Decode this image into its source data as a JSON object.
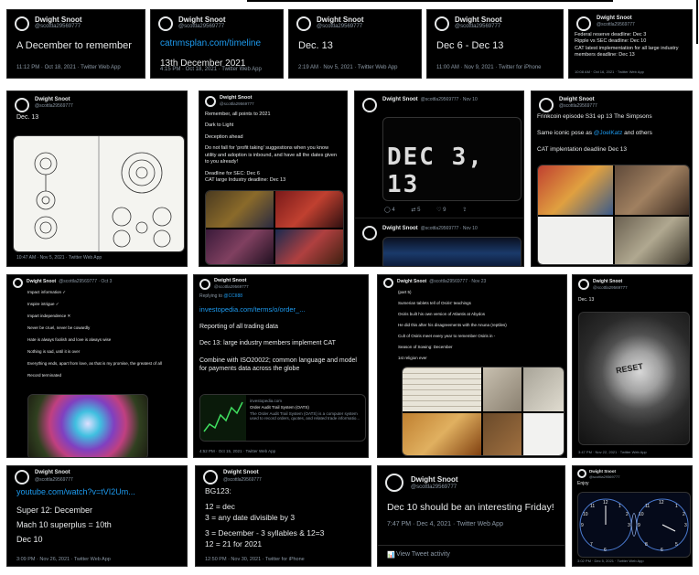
{
  "author": {
    "name": "Dwight Snoot",
    "handle": "@scottla29569777"
  },
  "tweets": {
    "t1": {
      "lines": [
        "A December to remember"
      ],
      "meta": "11:12 PM · Oct 18, 2021 · Twitter Web App"
    },
    "t2": {
      "link": "catnmsplan.com/timeline",
      "lines": [
        "13th December 2021"
      ],
      "meta": "4:15 PM · Oct 18, 2021 · Twitter Web App"
    },
    "t3": {
      "lines": [
        "Dec. 13"
      ],
      "meta": "2:19 AM · Nov 5, 2021 · Twitter Web App"
    },
    "t4": {
      "lines": [
        "Dec 6 - Dec 13"
      ],
      "meta": "11:00 AM · Nov 9, 2021 · Twitter for iPhone"
    },
    "t5": {
      "lines": [
        "Federal reserve deadline: Dec 3",
        "Ripple vs SEC deadline: Dec 10",
        "CAT latest implementation for all large industry members deadline: Dec 13"
      ],
      "meta": "10:08 AM · Oct 16, 2021 · Twitter Web App"
    },
    "t6": {
      "lines": [
        "Dec. 13"
      ],
      "meta": "10:47 AM · Nov 5, 2021 · Twitter Web App"
    },
    "t7": {
      "lines": [
        "Remember, all points to 2021",
        "Dark to Light",
        "Deception ahead",
        "Do not fall for 'profit taking' suggestions when you know utility and adoption is inbound, and have all the dates given to you already!",
        "Deadline for SEC: Dec 6",
        "CAT large Industry deadline: Dec 13"
      ]
    },
    "t8": {
      "meta": "@scottla29569777 · Nov 10",
      "image_text": "DEC 3, 13",
      "reply_handle": "@scottla29569777 · Nov 10",
      "actions": [
        "4",
        "5",
        "9"
      ]
    },
    "t9": {
      "lines": [
        "Frinkcoin episode S31 ep 13 The Simpsons"
      ],
      "line2_prefix": "Same iconic pose as ",
      "mention": "@JoelKatz",
      "line2_suffix": " and others",
      "line3": "CAT implentation deadline Dec 13"
    },
    "t10": {
      "meta": "@scottla29569777 · Oct 3",
      "lines": [
        "Impact information ✓",
        "Inspire intrigue ✓",
        "Impart independence ✕",
        "Never be cruel, never be cowardly",
        "Hate is always foolish and love is always wise",
        "Nothing is sad, until it is over",
        "Everything ends, apart from love, as that is my promise, the greatest of all",
        "Record terminated"
      ]
    },
    "t11": {
      "replying": "Replying to ",
      "reply_to": "@CCII88",
      "link": "investopedia.com/terms/o/order_...",
      "lines": [
        "Reporting of all trading data",
        "Dec 13: large industry members implement CAT",
        "Combine with ISO20022; common language and model for payments data across the globe"
      ],
      "card_domain": "investopedia.com",
      "card_title": "Order Audit Trail System (OATS)",
      "card_desc": "The Order Audit Trail System (OATS) is a computer system used to record orders, quotes, and related trade informatio...",
      "meta": "4:52 PM · Oct 15, 2021 · Twitter Web App"
    },
    "t12": {
      "meta": "@scottla29569777 · Nov 23",
      "lines": [
        "(part 5)",
        "Sumerian tablets tell of Osiris' teachings",
        "Osiris built his own version of Atlantis at Abydos",
        "He did this after his disagreements with the Anuna (reptiles)",
        "Cult of Osiris meet every year to remember Osiris in -",
        "Season of Sowing: December",
        "1st religion ever"
      ]
    },
    "t13": {
      "lines": [
        "Dec. 13"
      ],
      "image_text": "RESET",
      "meta": "3:47 PM · Nov 22, 2021 · Twitter Web App"
    },
    "t14": {
      "link": "youtube.com/watch?v=tVI2Um...",
      "lines": [
        "Super 12: December",
        "Mach 10 superplus = 10th",
        "Dec 10"
      ],
      "meta": "3:09 PM · Nov 26, 2021 · Twitter Web App"
    },
    "t15": {
      "lines": [
        "BG123:",
        "12 = dec",
        "3 = any date divisible by 3",
        "3 = December - 3 syllables & 12=3",
        "12 = 21 for 2021"
      ],
      "meta": "12:50 PM · Nov 30, 2021 · Twitter for iPhone"
    },
    "t16": {
      "lines": [
        "Dec 10 should be an interesting Friday!"
      ],
      "meta": "7:47 PM · Dec 4, 2021 · Twitter Web App",
      "activity": "View Tweet activity"
    },
    "t17": {
      "lines": [
        "Enjoy"
      ],
      "clock_left": [
        "12",
        "11",
        "1",
        "10",
        "2",
        "9",
        "3",
        "7",
        "6"
      ],
      "clock_right": [
        "12",
        "11",
        "1",
        "10",
        "2",
        "9",
        "3",
        "8",
        "6",
        "5"
      ],
      "meta": "3:02 PM · Dec 5, 2021 · Twitter Web App"
    }
  },
  "colors": {
    "background": "#000000",
    "text": "#e7e9ea",
    "muted": "#8b98a5",
    "link": "#1d9bf0"
  }
}
